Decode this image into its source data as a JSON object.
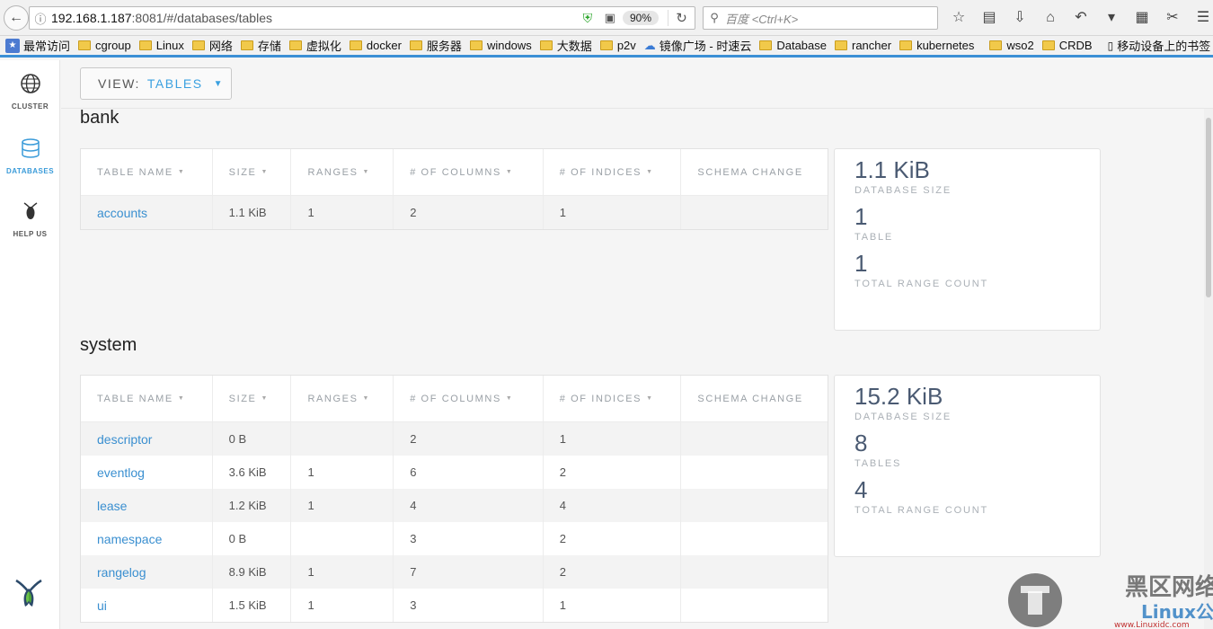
{
  "browser": {
    "url_host": "192.168.1.187",
    "url_rest": ":8081/#/databases/tables",
    "zoom": "90%",
    "search_placeholder": "百度 <Ctrl+K>"
  },
  "bookmarks": [
    {
      "label": "最常访问",
      "kind": "special"
    },
    {
      "label": "cgroup",
      "kind": "folder"
    },
    {
      "label": "Linux",
      "kind": "folder"
    },
    {
      "label": "网络",
      "kind": "folder"
    },
    {
      "label": "存储",
      "kind": "folder"
    },
    {
      "label": "虚拟化",
      "kind": "folder"
    },
    {
      "label": "docker",
      "kind": "folder"
    },
    {
      "label": "服务器",
      "kind": "folder"
    },
    {
      "label": "windows",
      "kind": "folder"
    },
    {
      "label": "大数据",
      "kind": "folder"
    },
    {
      "label": "p2v",
      "kind": "folder"
    },
    {
      "label": "镜像广场 - 时速云",
      "kind": "cloud"
    },
    {
      "label": "Database",
      "kind": "folder"
    },
    {
      "label": "rancher",
      "kind": "folder"
    },
    {
      "label": "kubernetes",
      "kind": "folder"
    },
    {
      "label": "wso2",
      "kind": "folder"
    },
    {
      "label": "CRDB",
      "kind": "folder"
    },
    {
      "label": "移动设备上的书签",
      "kind": "phone"
    }
  ],
  "sidebar": {
    "items": [
      {
        "label": "CLUSTER",
        "icon": "globe-icon"
      },
      {
        "label": "DATABASES",
        "icon": "database-icon"
      },
      {
        "label": "HELP US",
        "icon": "cockroach-icon"
      }
    ]
  },
  "view": {
    "key": "VIEW:",
    "value": "TABLES"
  },
  "columns": [
    "TABLE NAME",
    "SIZE",
    "RANGES",
    "# OF COLUMNS",
    "# OF INDICES",
    "SCHEMA CHANGE"
  ],
  "databases": [
    {
      "name": "bank",
      "rows": [
        {
          "name": "accounts",
          "size": "1.1 KiB",
          "ranges": "1",
          "columns": "2",
          "indices": "1",
          "schema": ""
        }
      ],
      "stats": {
        "size": "1.1 KiB",
        "size_label": "DATABASE SIZE",
        "tables": "1",
        "tables_label": "TABLE",
        "ranges": "1",
        "ranges_label": "TOTAL RANGE COUNT"
      }
    },
    {
      "name": "system",
      "rows": [
        {
          "name": "descriptor",
          "size": "0 B",
          "ranges": "",
          "columns": "2",
          "indices": "1",
          "schema": ""
        },
        {
          "name": "eventlog",
          "size": "3.6 KiB",
          "ranges": "1",
          "columns": "6",
          "indices": "2",
          "schema": ""
        },
        {
          "name": "lease",
          "size": "1.2 KiB",
          "ranges": "1",
          "columns": "4",
          "indices": "4",
          "schema": ""
        },
        {
          "name": "namespace",
          "size": "0 B",
          "ranges": "",
          "columns": "3",
          "indices": "2",
          "schema": ""
        },
        {
          "name": "rangelog",
          "size": "8.9 KiB",
          "ranges": "1",
          "columns": "7",
          "indices": "2",
          "schema": ""
        },
        {
          "name": "ui",
          "size": "1.5 KiB",
          "ranges": "1",
          "columns": "3",
          "indices": "1",
          "schema": ""
        }
      ],
      "stats": {
        "size": "15.2 KiB",
        "size_label": "DATABASE SIZE",
        "tables": "8",
        "tables_label": "TABLES",
        "ranges": "4",
        "ranges_label": "TOTAL RANGE COUNT"
      }
    }
  ],
  "watermark": {
    "brand": "黑区网络",
    "site": "Linux公社",
    "url": "www.Linuxidc.com"
  },
  "colors": {
    "accent": "#3aa0e0",
    "link": "#3a8fd0",
    "stat_number": "#4a5a72"
  }
}
